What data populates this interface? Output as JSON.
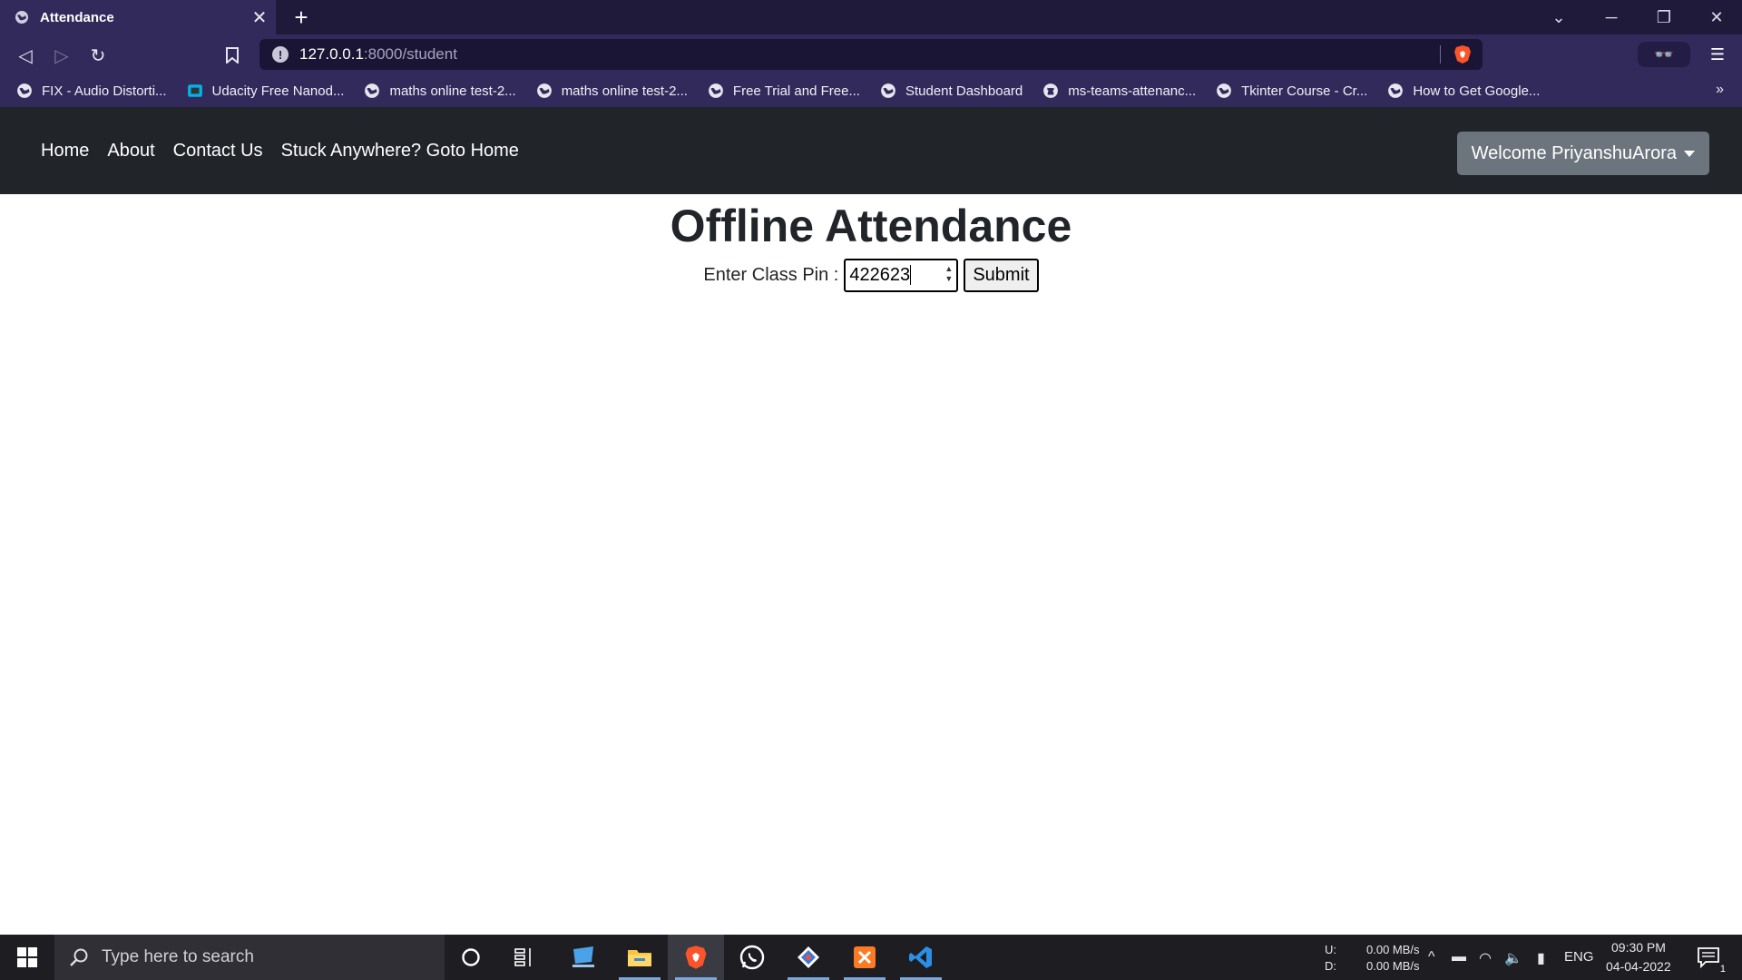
{
  "browser": {
    "tab_title": "Attendance",
    "tab_close": "✕",
    "new_tab": "+",
    "url_host": "127.0.0.1",
    "url_rest": ":8000/student",
    "bookmarks": [
      "FIX - Audio Distorti...",
      "Udacity Free Nanod...",
      "maths online test-2...",
      "maths online test-2...",
      "Free Trial and Free...",
      "Student Dashboard",
      "ms-teams-attenanc...",
      "Tkinter Course - Cr...",
      "How to Get Google..."
    ],
    "bookmarks_more": "»"
  },
  "site": {
    "nav": [
      "Home",
      "About",
      "Contact Us",
      "Stuck Anywhere? Goto Home"
    ],
    "welcome": "Welcome PriyanshuArora",
    "heading": "Offline Attendance",
    "pin_label": "Enter Class Pin :",
    "pin_value": "422623",
    "submit": "Submit"
  },
  "taskbar": {
    "search_placeholder": "Type here to search",
    "net_up_label": "U:",
    "net_down_label": "D:",
    "net_up": "0.00 MB/s",
    "net_down": "0.00 MB/s",
    "lang": "ENG",
    "time": "09:30 PM",
    "date": "04-04-2022",
    "notif_count": "1"
  }
}
